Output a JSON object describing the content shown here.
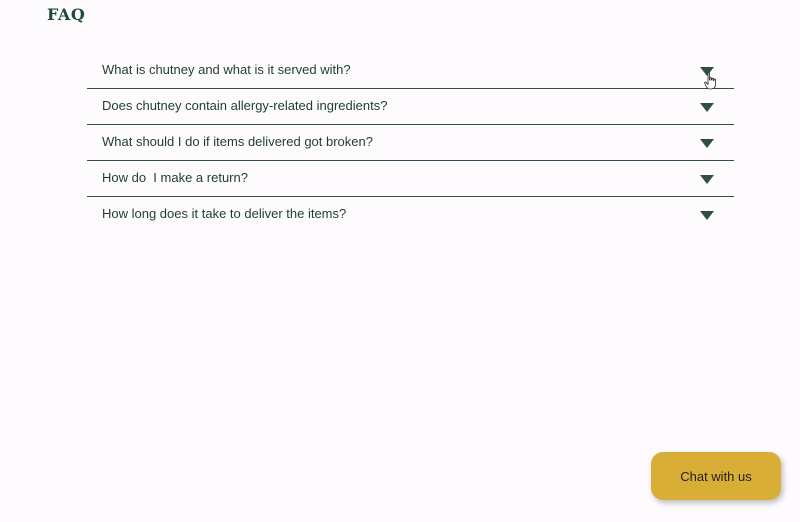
{
  "header": {
    "title": "FAQ"
  },
  "faq": {
    "items": [
      {
        "question": "What is chutney and what is it served with?",
        "icon": "chevron-down-icon"
      },
      {
        "question": "Does chutney contain allergy-related ingredients?",
        "icon": "chevron-down-icon"
      },
      {
        "question": "What should I do if items delivered got broken?",
        "icon": "chevron-down-icon"
      },
      {
        "question": "How do  I make a return?",
        "icon": "chevron-down-icon"
      },
      {
        "question": "How long does it take to deliver the items?",
        "icon": "chevron-down-icon"
      }
    ]
  },
  "chat": {
    "label": "Chat with us"
  },
  "colors": {
    "background": "#fdfbfd",
    "text": "#1f4a3a",
    "divider": "#2f4f45",
    "chat_button": "#d9ae36"
  }
}
